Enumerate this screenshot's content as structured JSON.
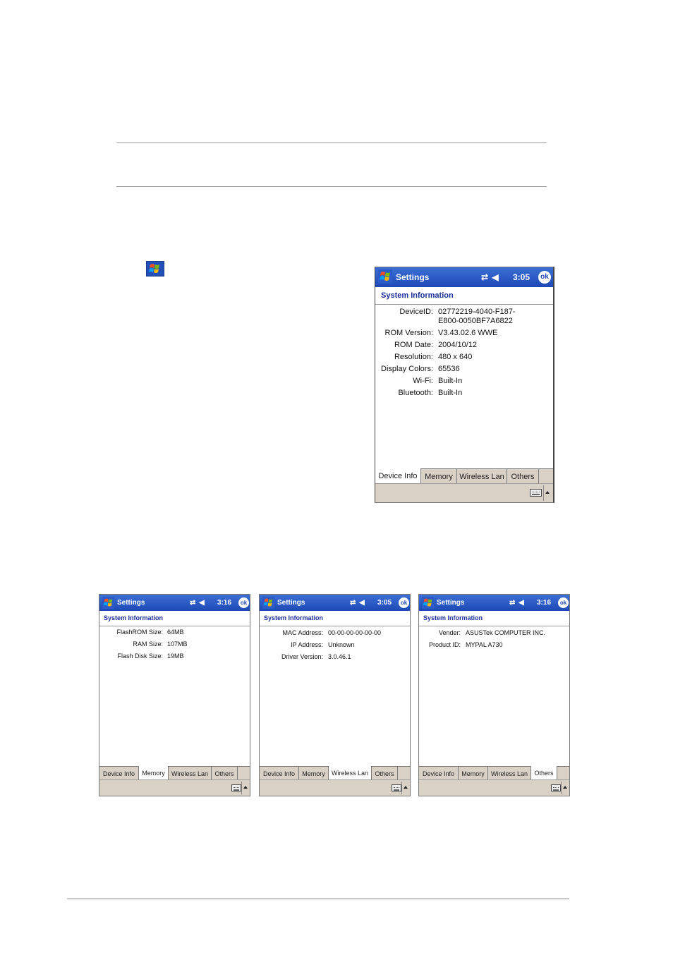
{
  "main_device": {
    "title": "Settings",
    "status_icons": "⇄ ◀",
    "time": "3:05",
    "ok_label": "ok",
    "heading": "System Information",
    "rows": [
      {
        "label": "DeviceID:",
        "value": "02772219-4040-F187-",
        "value2": "E800-0050BF7A6822"
      },
      {
        "label": "ROM Version:",
        "value": "V3.43.02.6 WWE"
      },
      {
        "label": "ROM Date:",
        "value": "2004/10/12"
      },
      {
        "label": "Resolution:",
        "value": "480 x 640"
      },
      {
        "label": "Display Colors:",
        "value": "65536"
      },
      {
        "label": "Wi-Fi:",
        "value": "Built-In"
      },
      {
        "label": "Bluetooth:",
        "value": "Built-In"
      }
    ],
    "tabs": [
      "Device Info",
      "Memory",
      "Wireless Lan",
      "Others"
    ],
    "active_tab": "Device Info"
  },
  "memory_device": {
    "title": "Settings",
    "status_icons": "⇄ ◀",
    "time": "3:16",
    "ok_label": "ok",
    "heading": "System Information",
    "rows": [
      {
        "label": "FlashROM Size:",
        "value": "64MB"
      },
      {
        "label": "RAM Size:",
        "value": "107MB"
      },
      {
        "label": "Flash Disk Size:",
        "value": "19MB"
      }
    ],
    "tabs": [
      "Device Info",
      "Memory",
      "Wireless Lan",
      "Others"
    ],
    "active_tab": "Memory"
  },
  "wireless_device": {
    "title": "Settings",
    "status_icons": "⇄ ◀",
    "time": "3:05",
    "ok_label": "ok",
    "heading": "System Information",
    "rows": [
      {
        "label": "MAC Address:",
        "value": "00-00-00-00-00-00"
      },
      {
        "label": "IP Address:",
        "value": "Unknown"
      },
      {
        "label": "Driver Version:",
        "value": "3.0.46.1"
      }
    ],
    "tabs": [
      "Device Info",
      "Memory",
      "Wireless Lan",
      "Others"
    ],
    "active_tab": "Wireless Lan"
  },
  "others_device": {
    "title": "Settings",
    "status_icons": "⇄ ◀",
    "time": "3:16",
    "ok_label": "ok",
    "heading": "System Information",
    "rows": [
      {
        "label": "Vender:",
        "value": "ASUSTek COMPUTER INC."
      },
      {
        "label": "Product ID:",
        "value": "MYPAL A730"
      }
    ],
    "tabs": [
      "Device Info",
      "Memory",
      "Wireless Lan",
      "Others"
    ],
    "active_tab": "Others"
  },
  "colors": {
    "titlebar": "#1f49b5",
    "heading_text": "#1b2e9b",
    "tab_bar": "#d9d0c6"
  },
  "icons": {
    "start": "windows-flag-icon",
    "keyboard": "keyboard-icon",
    "sip_arrow": "up-arrow-icon"
  }
}
